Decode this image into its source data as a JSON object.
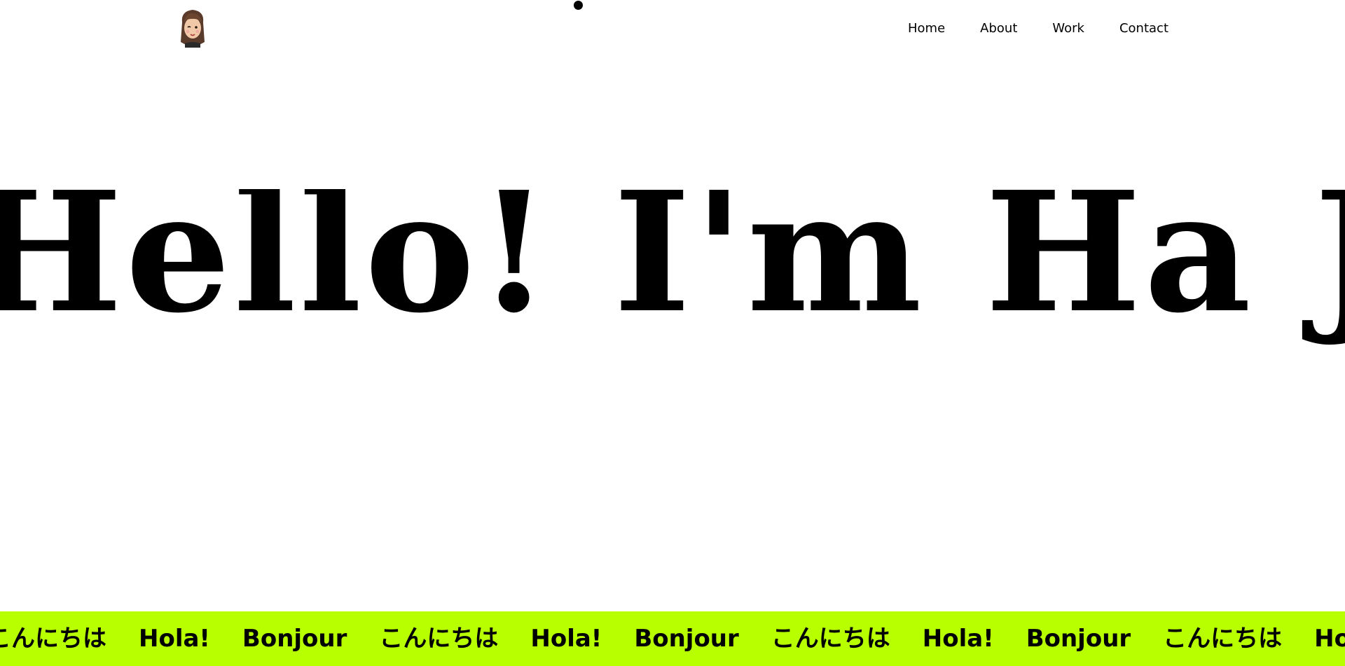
{
  "header": {
    "nav": [
      {
        "label": "Home"
      },
      {
        "label": "About"
      },
      {
        "label": "Work"
      },
      {
        "label": "Contact"
      }
    ]
  },
  "hero": {
    "title": "Hello! I'm Ha Ji—"
  },
  "marquee": {
    "background": "#b8ff00",
    "items": [
      "こんにちは",
      "Hola!",
      "Bonjour",
      "こんにちは",
      "Hola!",
      "Bonjour",
      "こんにちは",
      "Hola!",
      "Bonjour",
      "こんにちは",
      "Hola!"
    ]
  },
  "icons": {
    "avatar": "memoji-avatar-icon",
    "cursor": "cursor-dot-icon"
  }
}
